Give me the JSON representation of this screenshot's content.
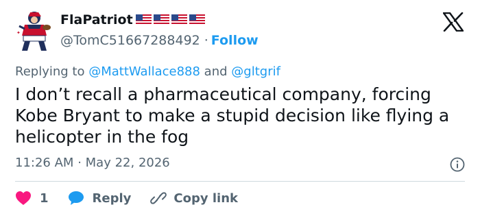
{
  "author": {
    "name": "FlaPatriot",
    "handle": "@TomC51667288492",
    "separator": "·",
    "follow_label": "Follow",
    "flags": [
      "us-flag-icon",
      "us-flag-icon",
      "us-flag-icon",
      "us-flag-icon"
    ]
  },
  "replying": {
    "prefix": "Replying to",
    "mention1": "@MattWallace888",
    "conjunction": "and",
    "mention2": "@gltgrif"
  },
  "tweet": {
    "text": "I don’t recall a pharmaceutical company, forcing Kobe Bryant to make a stupid decision like flying a helicopter in the fog",
    "time": "11:26 AM",
    "dot": "·",
    "date": "May 22, 2026"
  },
  "actions": {
    "like_count": "1",
    "reply_label": "Reply",
    "copy_label": "Copy link"
  },
  "colors": {
    "like": "#f91880",
    "reply": "#1d9bf0",
    "link": "#1d9bf0",
    "secondary_text": "#536471"
  }
}
